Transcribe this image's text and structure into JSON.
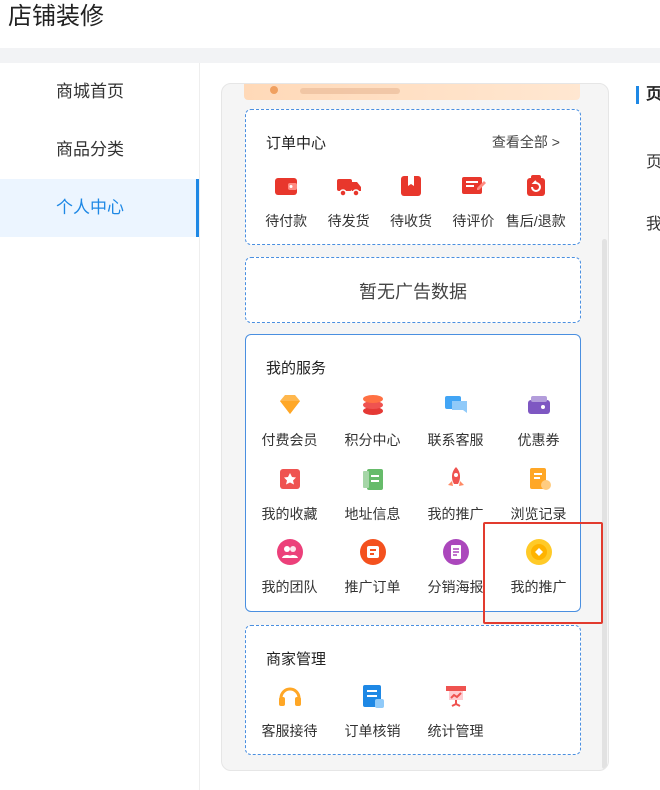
{
  "page": {
    "title": "店铺装修"
  },
  "sidebar": {
    "items": [
      {
        "label": "商城首页"
      },
      {
        "label": "商品分类"
      },
      {
        "label": "个人中心"
      }
    ]
  },
  "order_center": {
    "title": "订单中心",
    "view_all": "查看全部 >",
    "items": [
      {
        "label": "待付款",
        "icon": "wallet-icon"
      },
      {
        "label": "待发货",
        "icon": "truck-icon"
      },
      {
        "label": "待收货",
        "icon": "package-icon"
      },
      {
        "label": "待评价",
        "icon": "review-icon"
      },
      {
        "label": "售后/退款",
        "icon": "refund-icon"
      }
    ]
  },
  "ad": {
    "empty_text": "暂无广告数据"
  },
  "my_services": {
    "title": "我的服务",
    "items": [
      {
        "label": "付费会员",
        "icon": "diamond-icon"
      },
      {
        "label": "积分中心",
        "icon": "coins-icon"
      },
      {
        "label": "联系客服",
        "icon": "chat-icon"
      },
      {
        "label": "优惠券",
        "icon": "coupon-icon"
      },
      {
        "label": "我的收藏",
        "icon": "star-icon"
      },
      {
        "label": "地址信息",
        "icon": "address-icon"
      },
      {
        "label": "我的推广",
        "icon": "rocket-icon"
      },
      {
        "label": "浏览记录",
        "icon": "history-icon"
      },
      {
        "label": "我的团队",
        "icon": "team-icon"
      },
      {
        "label": "推广订单",
        "icon": "promo-order-icon"
      },
      {
        "label": "分销海报",
        "icon": "poster-icon"
      },
      {
        "label": "我的推广",
        "icon": "promotion-icon"
      }
    ]
  },
  "merchant": {
    "title": "商家管理",
    "items": [
      {
        "label": "客服接待",
        "icon": "headset-icon"
      },
      {
        "label": "订单核销",
        "icon": "verify-icon"
      },
      {
        "label": "统计管理",
        "icon": "stats-icon"
      }
    ]
  },
  "right_panel": {
    "heading": "页",
    "line1": "页",
    "line2": "我"
  },
  "colors": {
    "accent": "#1e88e5",
    "order_red": "#e8372c",
    "dashed_border": "#4a8fe0",
    "highlight": "#e23b2e"
  }
}
